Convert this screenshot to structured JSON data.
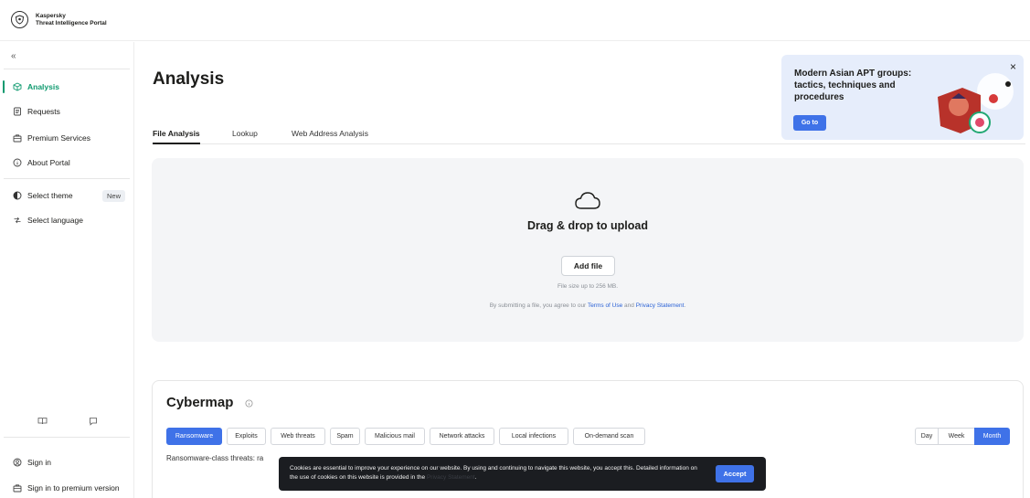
{
  "header": {
    "brand_line1": "Kaspersky",
    "brand_line2": "Threat Intelligence Portal"
  },
  "sidebar": {
    "collapse_icon": "double-chevron-left-icon",
    "items": [
      {
        "label": "Analysis",
        "icon": "cube-icon",
        "active": true
      },
      {
        "label": "Requests",
        "icon": "document-icon",
        "active": false
      },
      {
        "label": "Premium Services",
        "icon": "briefcase-icon",
        "active": false
      },
      {
        "label": "About Portal",
        "icon": "info-icon",
        "active": false
      }
    ],
    "theme": {
      "label": "Select theme",
      "badge": "New"
    },
    "language": {
      "label": "Select language"
    },
    "sign_in": "Sign in",
    "sign_in_premium": "Sign in to premium version"
  },
  "main": {
    "title": "Analysis",
    "tabs": [
      {
        "label": "File Analysis",
        "active": true
      },
      {
        "label": "Lookup",
        "active": false
      },
      {
        "label": "Web Address Analysis",
        "active": false
      }
    ]
  },
  "promo": {
    "title": "Modern Asian APT groups: tactics, techniques and procedures",
    "button": "Go to",
    "close": "×"
  },
  "upload": {
    "heading": "Drag & drop to upload",
    "button": "Add file",
    "size_note": "File size up to 256 MB.",
    "terms_prefix": "By submitting a file, you agree to our",
    "terms_link": "Terms of Use",
    "terms_and": "and",
    "privacy_link": "Privacy Statement",
    "terms_suffix": "."
  },
  "cybermap": {
    "title": "Cybermap",
    "filters": [
      {
        "label": "Ransomware",
        "active": true
      },
      {
        "label": "Exploits",
        "active": false
      },
      {
        "label": "Web threats",
        "active": false
      },
      {
        "label": "Spam",
        "active": false
      },
      {
        "label": "Malicious mail",
        "active": false
      },
      {
        "label": "Network attacks",
        "active": false
      },
      {
        "label": "Local infections",
        "active": false
      },
      {
        "label": "On-demand scan",
        "active": false
      }
    ],
    "periods": [
      {
        "label": "Day",
        "active": false
      },
      {
        "label": "Week",
        "active": false
      },
      {
        "label": "Month",
        "active": true
      }
    ],
    "subtitle": "Ransomware-class threats: ra"
  },
  "cookie": {
    "text": "Cookies are essential to improve your experience on our website. By using and continuing to navigate this website, you accept this. Detailed information on the use of cookies on this website is provided in the",
    "link": "Privacy Statement",
    "suffix": ".",
    "accept": "Accept"
  },
  "colors": {
    "accent_green": "#0f9a6f",
    "primary_blue": "#3f72e8",
    "promo_bg": "#e6edfb",
    "upload_bg": "#f4f5f7",
    "cookie_bg": "#1b1d21"
  }
}
